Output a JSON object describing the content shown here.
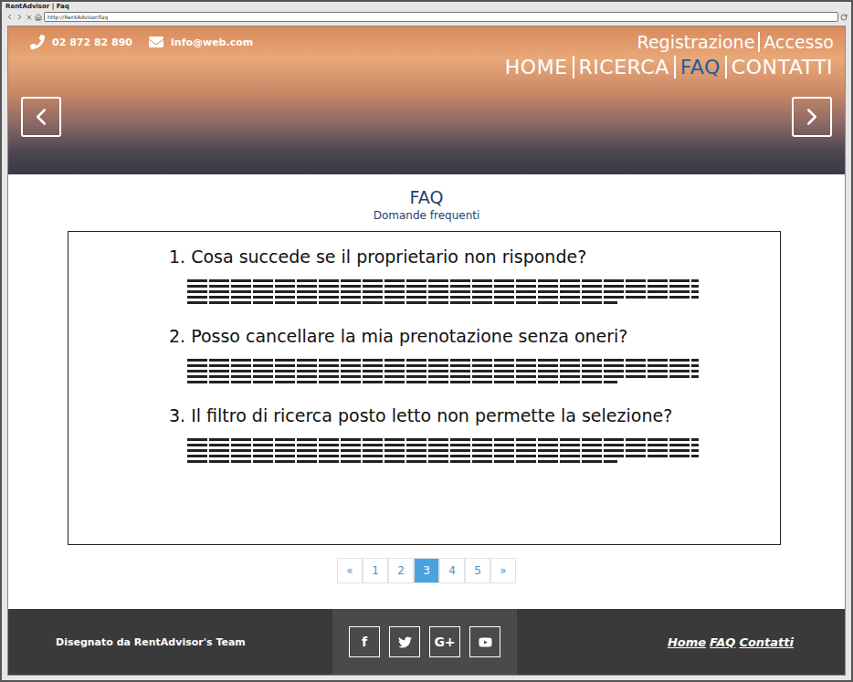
{
  "window": {
    "title": "RentAdvisor | Faq",
    "url": "http://RentAdvisor/faq"
  },
  "contact": {
    "phone": "02 872 82 890",
    "email": "info@web.com"
  },
  "account_links": [
    "Registrazione",
    "Accesso"
  ],
  "nav": [
    {
      "label": "HOME",
      "selected": false
    },
    {
      "label": "RICERCA",
      "selected": false
    },
    {
      "label": "FAQ",
      "selected": true
    },
    {
      "label": "CONTATTI",
      "selected": false
    }
  ],
  "page": {
    "title": "FAQ",
    "subtitle": "Domande frequenti"
  },
  "faq": [
    {
      "question": "1. Cosa succede se il proprietario non risponde?"
    },
    {
      "question": "2. Posso cancellare la mia prenotazione senza oneri?"
    },
    {
      "question": "3. Il filtro di ricerca posto letto non permette la selezione?"
    }
  ],
  "pagination": [
    {
      "label": "«",
      "selected": false
    },
    {
      "label": "1",
      "selected": false
    },
    {
      "label": "2",
      "selected": false
    },
    {
      "label": "3",
      "selected": true
    },
    {
      "label": "4",
      "selected": false
    },
    {
      "label": "5",
      "selected": false
    },
    {
      "label": "»",
      "selected": false
    }
  ],
  "footer": {
    "credit": "Disegnato da RentAdvisor's Team",
    "social": [
      {
        "kind": "text",
        "label": "f"
      },
      {
        "kind": "twitter"
      },
      {
        "kind": "text",
        "label": "G+"
      },
      {
        "kind": "youtube"
      }
    ],
    "links": [
      "Home",
      "FAQ",
      "Contatti"
    ]
  }
}
